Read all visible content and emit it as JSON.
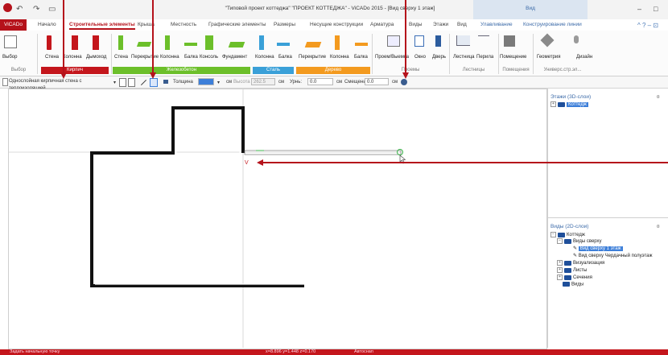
{
  "window": {
    "title": "\"Типовой проект коттеджа\" \"ПРОЕКТ КОТТЕДЖА\" - ViCADo 2015 - [Вид сверху 1 этаж]",
    "context_group": "Вид",
    "min": "–",
    "max": "□"
  },
  "quick_access": {
    "undo": "↶",
    "redo": "↷",
    "save": "▭"
  },
  "tabs": {
    "file": "ViCADo",
    "items": [
      "Начало",
      "Строительные элементы",
      "Крыша",
      "Местность",
      "Графические элементы",
      "Размеры",
      "Несущие конструкции",
      "Арматура",
      "Виды",
      "Этажи",
      "Вид"
    ],
    "context": [
      "Улавливание",
      "Конструирование линии"
    ],
    "help": "^ ? – ⊡"
  },
  "ribbon": {
    "buttons": [
      "Выбор",
      "Стена",
      "Колонна",
      "Дымоход",
      "Стена",
      "Перекрытие",
      "Колонна",
      "Балка",
      "Консоль",
      "Фундамент",
      "Колонна",
      "Балка",
      "Перекрытие",
      "Колонна",
      "Балка",
      "Проем/Выемка",
      "Окно",
      "Дверь",
      "Лестница",
      "Перила",
      "Помещение",
      "Геометрия",
      "Дизайн"
    ],
    "groups": {
      "select": "Выбор",
      "brick": "Кирпич",
      "concrete": "Железобетон",
      "steel": "Сталь",
      "wood": "Дерево",
      "openings": "Проемы",
      "stairs": "Лестницы",
      "rooms": "Помещения",
      "universal": "Универс.стр.эл..."
    },
    "colors": {
      "brick": "#c4161c",
      "concrete": "#6cbf2a",
      "steel": "#3aa0d8",
      "wood": "#f39a1f",
      "accent": "#b5121b"
    }
  },
  "options": {
    "wall_type": "Однослойная кирпичная стена с теплоизоляцией",
    "thickness_label": "Толщина",
    "thickness_value": "",
    "unit_cm": "см",
    "height_label": "Высота",
    "height_value": "262.5",
    "level_label": "Урнь:",
    "level_value": "0.0",
    "offset_label": "Смещени",
    "offset_value": "0.0"
  },
  "canvas": {
    "snap_marker": "V"
  },
  "floors_panel": {
    "title": "Этажи (3D-слои)",
    "pin": "¤",
    "items": [
      "Коттедж"
    ]
  },
  "views_panel": {
    "title": "Виды (2D-слои)",
    "pin": "¤",
    "root": "Коттедж",
    "top_views": "Виды сверху",
    "view_1": "Вид сверху 1 этаж",
    "view_2": "Вид сверху Чердачный полуэтаж",
    "visualization": "Визуализация",
    "sheets": "Листы",
    "sections": "Сечения",
    "views": "Виды"
  },
  "status": {
    "left": "Задать начальную точку",
    "coords": "x=8.896   y=1.448   z=0.170",
    "snap": "Автоснап"
  }
}
